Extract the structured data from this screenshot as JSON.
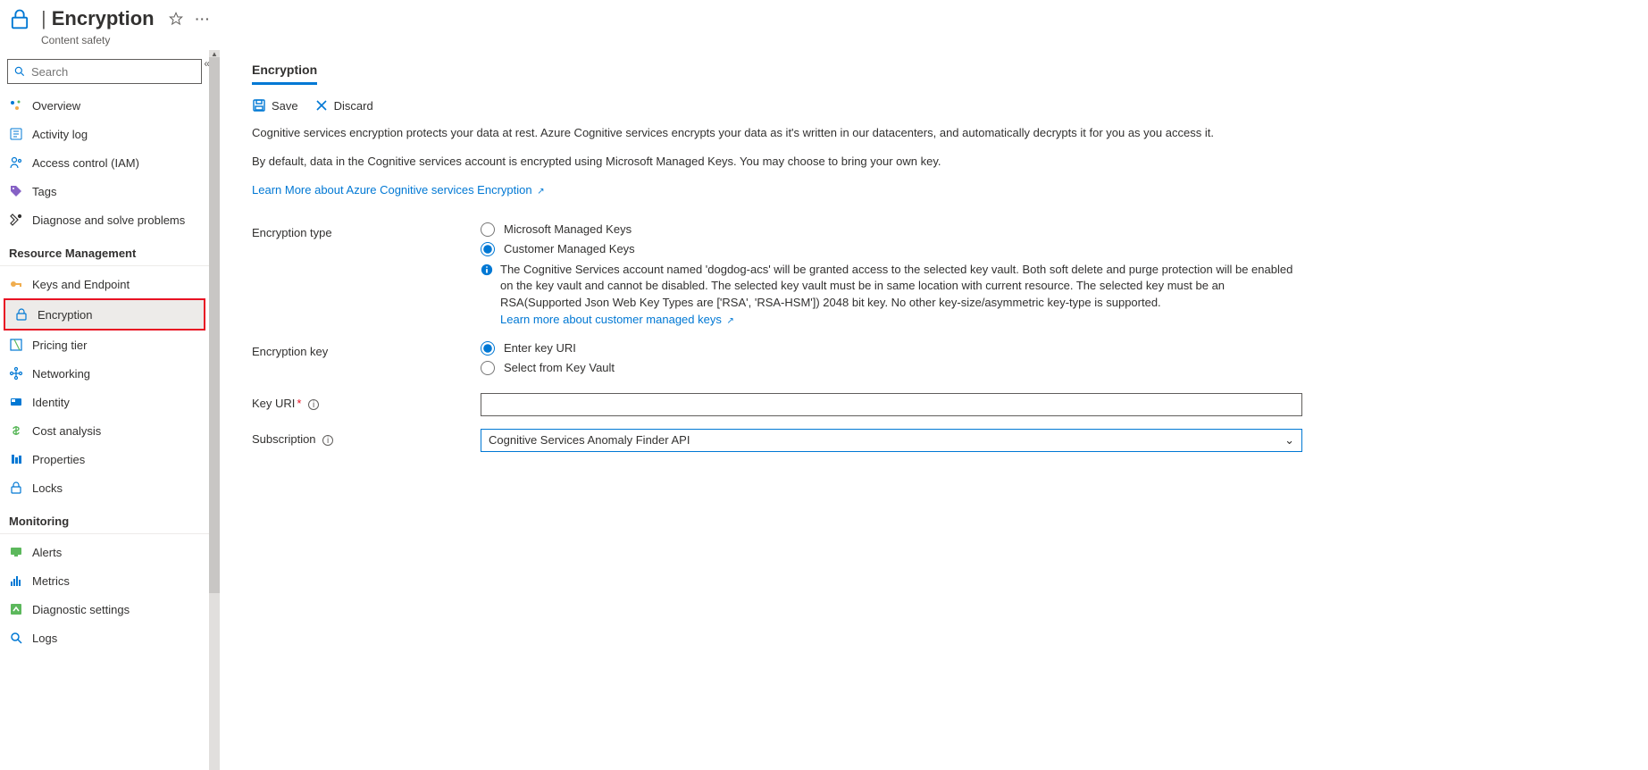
{
  "header": {
    "title": "Encryption",
    "subtype": "Content safety"
  },
  "search": {
    "placeholder": "Search"
  },
  "nav": {
    "items_top": [
      {
        "label": "Overview"
      },
      {
        "label": "Activity log"
      },
      {
        "label": "Access control (IAM)"
      },
      {
        "label": "Tags"
      },
      {
        "label": "Diagnose and solve problems"
      }
    ],
    "group_resource": {
      "header": "Resource Management",
      "items": [
        {
          "label": "Keys and Endpoint"
        },
        {
          "label": "Encryption"
        },
        {
          "label": "Pricing tier"
        },
        {
          "label": "Networking"
        },
        {
          "label": "Identity"
        },
        {
          "label": "Cost analysis"
        },
        {
          "label": "Properties"
        },
        {
          "label": "Locks"
        }
      ]
    },
    "group_monitoring": {
      "header": "Monitoring",
      "items": [
        {
          "label": "Alerts"
        },
        {
          "label": "Metrics"
        },
        {
          "label": "Diagnostic settings"
        },
        {
          "label": "Logs"
        }
      ]
    }
  },
  "main": {
    "tab_label": "Encryption",
    "cmd": {
      "save": "Save",
      "discard": "Discard"
    },
    "desc1": "Cognitive services encryption protects your data at rest. Azure Cognitive services encrypts your data as it's written in our datacenters, and automatically decrypts it for you as you access it.",
    "desc2": "By default, data in the Cognitive services account is encrypted using Microsoft Managed Keys. You may choose to bring your own key.",
    "learn_more": "Learn More about Azure Cognitive services Encryption",
    "labels": {
      "encryption_type": "Encryption type",
      "encryption_key": "Encryption key",
      "key_uri": "Key URI",
      "subscription": "Subscription"
    },
    "options": {
      "mmk": "Microsoft Managed Keys",
      "cmk": "Customer Managed Keys",
      "enter_uri": "Enter key URI",
      "select_kv": "Select from Key Vault"
    },
    "info_text": "The Cognitive Services account named 'dogdog-acs' will be granted access to the selected key vault. Both soft delete and purge protection will be enabled on the key vault and cannot be disabled. The selected key vault must be in same location with current resource. The selected key must be an RSA(Supported Json Web Key Types are ['RSA', 'RSA-HSM']) 2048 bit key. No other key-size/asymmetric key-type is supported.",
    "info_link": "Learn more about customer managed keys",
    "subscription_value": "Cognitive Services Anomaly Finder API"
  }
}
